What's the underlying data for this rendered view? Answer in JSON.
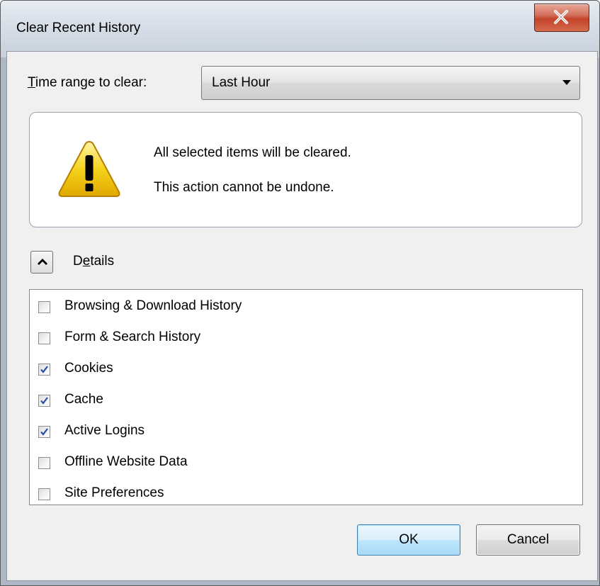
{
  "window": {
    "title": "Clear Recent History"
  },
  "time_range": {
    "label_prefix": "",
    "label_accel": "T",
    "label_rest": "ime range to clear:",
    "selected": "Last Hour"
  },
  "warning": {
    "icon": "warning-triangle-icon",
    "line1": "All selected items will be cleared.",
    "line2": "This action cannot be undone."
  },
  "details": {
    "label_prefix": "D",
    "label_accel": "e",
    "label_rest": "tails",
    "expanded": true
  },
  "items": [
    {
      "label": "Browsing & Download History",
      "checked": false
    },
    {
      "label": "Form & Search History",
      "checked": false
    },
    {
      "label": "Cookies",
      "checked": true
    },
    {
      "label": "Cache",
      "checked": true
    },
    {
      "label": "Active Logins",
      "checked": true
    },
    {
      "label": "Offline Website Data",
      "checked": false
    },
    {
      "label": "Site Preferences",
      "checked": false
    }
  ],
  "buttons": {
    "ok": "OK",
    "cancel": "Cancel"
  },
  "colors": {
    "ok_accent": "#3c7fb1",
    "close_red": "#c3432a",
    "warning_yellow": "#f5d31c"
  }
}
